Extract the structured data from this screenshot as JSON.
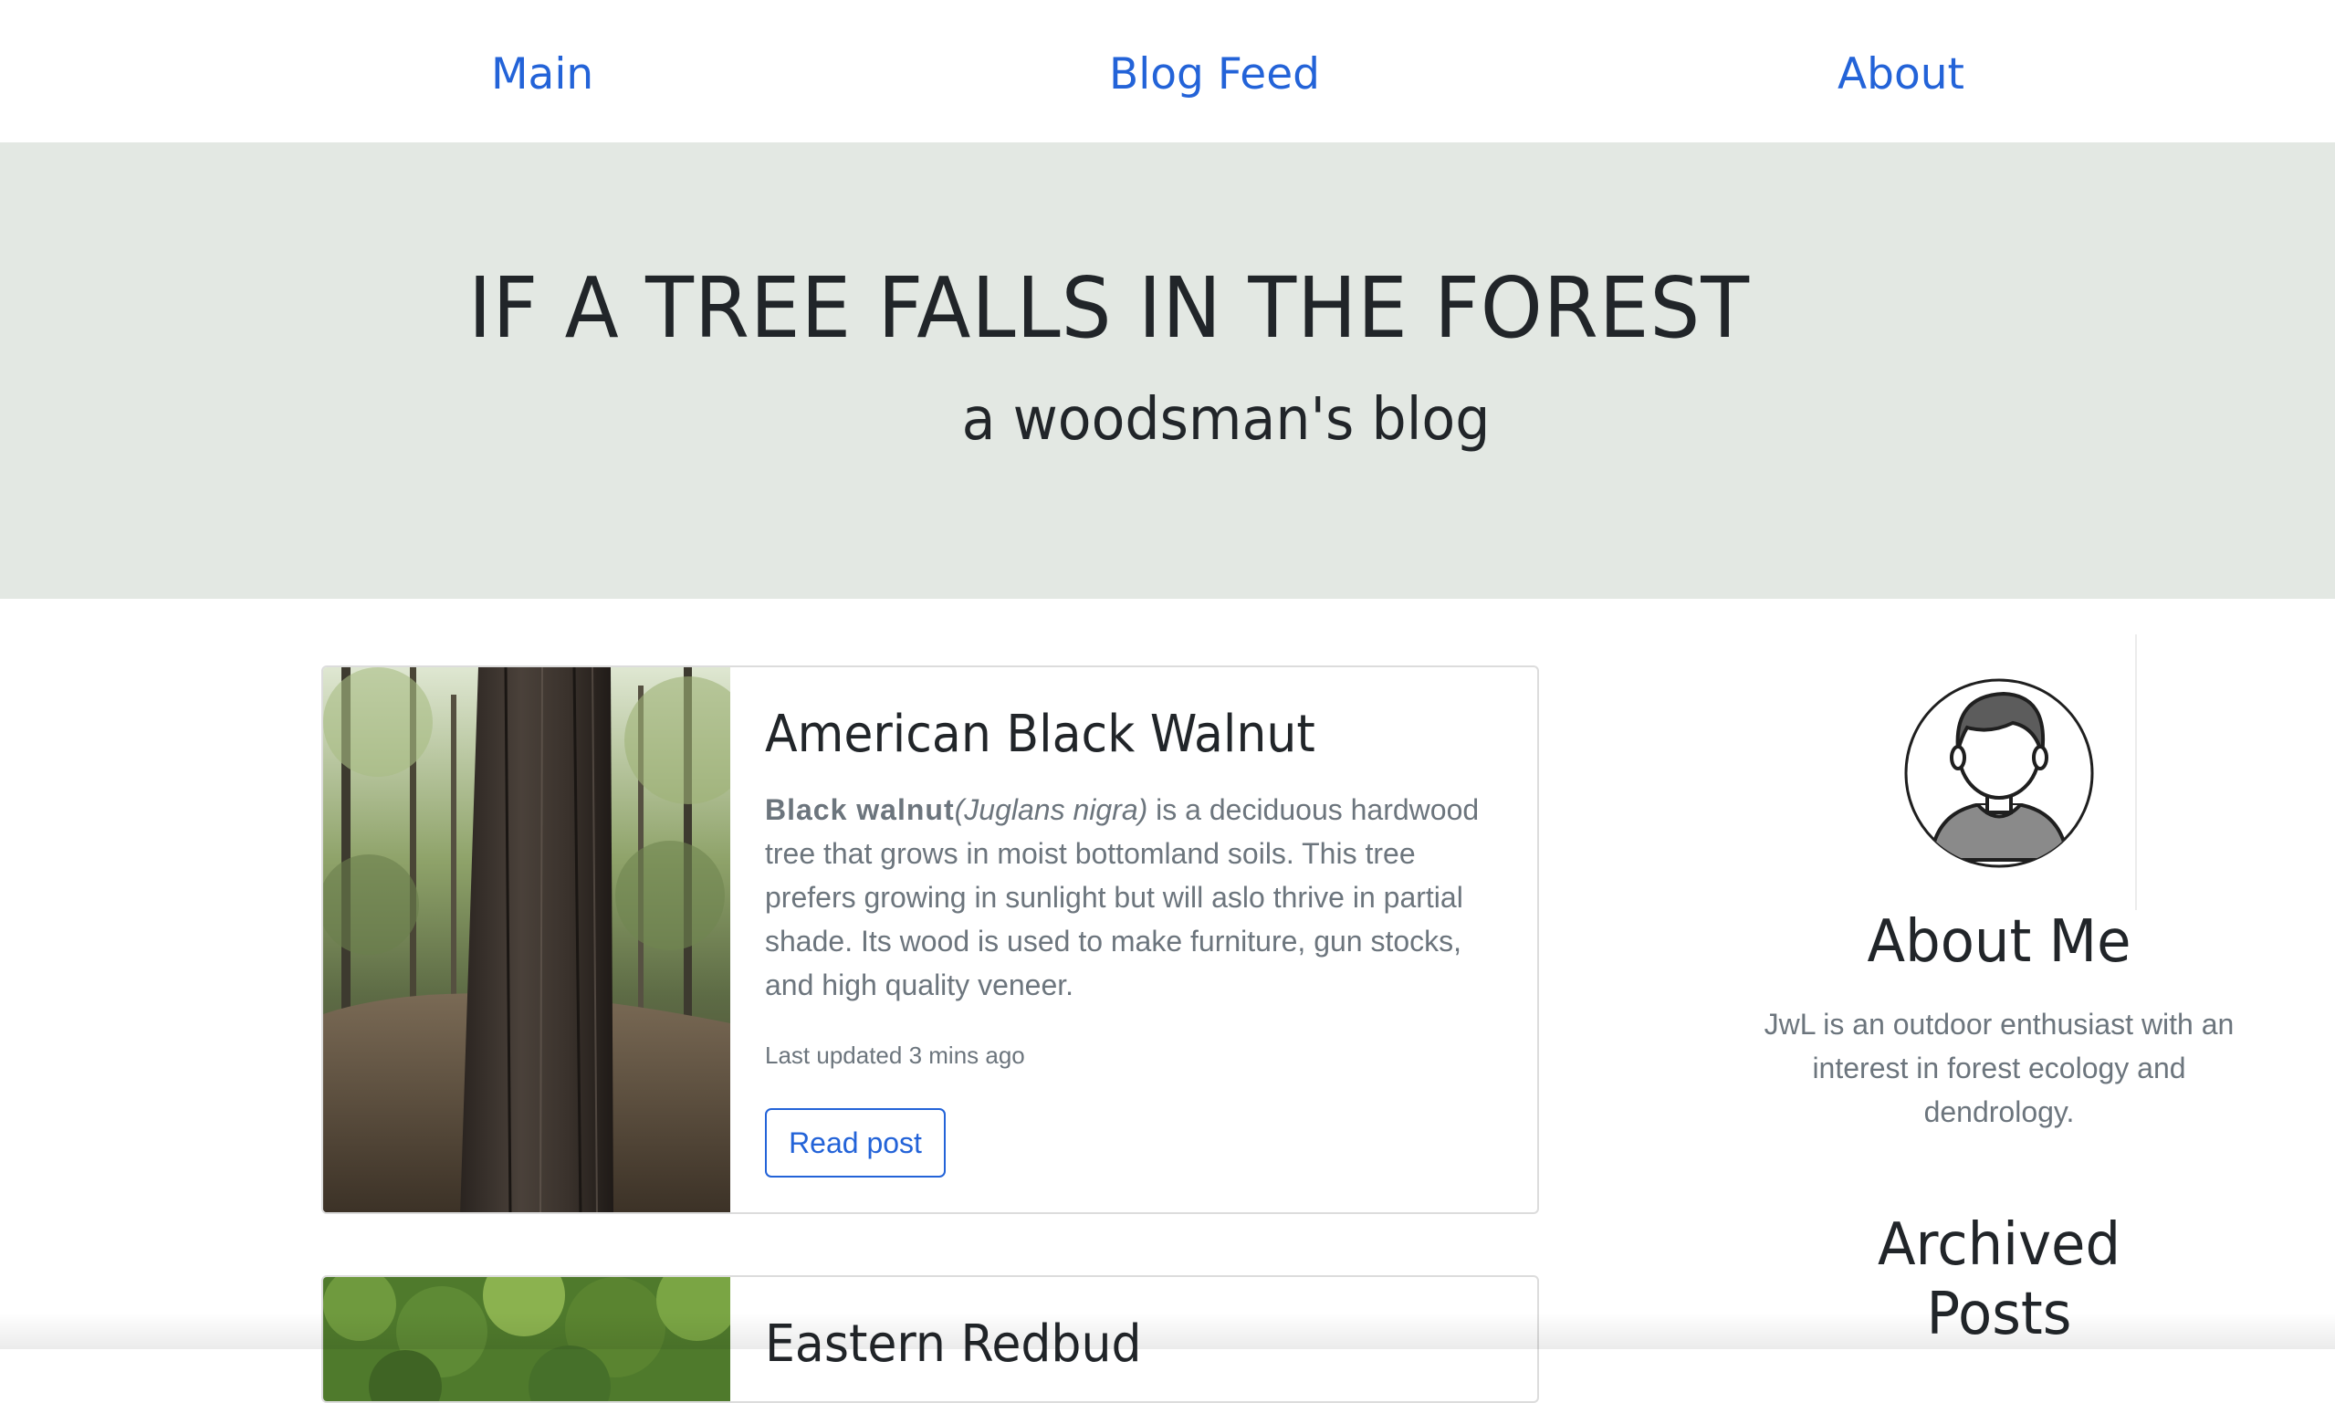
{
  "nav": {
    "items": [
      {
        "label": "Main"
      },
      {
        "label": "Blog Feed"
      },
      {
        "label": "About"
      }
    ]
  },
  "hero": {
    "title": "IF A TREE FALLS IN THE FOREST",
    "subtitle": "a woodsman's blog"
  },
  "posts": [
    {
      "title": "American Black Walnut",
      "common_name": "Black walnut",
      "scientific_name": "(Juglans nigra)",
      "description": " is a deciduous hardwood tree that grows in moist bottomland soils. This tree prefers growing in sunlight but will aslo thrive in partial shade. Its wood is used to make furniture, gun stocks, and high quality veneer.",
      "meta": "Last updated 3 mins ago",
      "button_label": "Read post"
    },
    {
      "title": "Eastern Redbud"
    }
  ],
  "sidebar": {
    "about_heading": "About Me",
    "about_text": "JwL is an outdoor enthusiast with an interest in forest ecology and dendrology.",
    "archive_heading_line1": "Archived",
    "archive_heading_line2": "Posts"
  },
  "colors": {
    "link": "#2363d8",
    "hero_bg": "#e3e8e3",
    "text_muted": "#6c757d",
    "text_dark": "#212529"
  }
}
